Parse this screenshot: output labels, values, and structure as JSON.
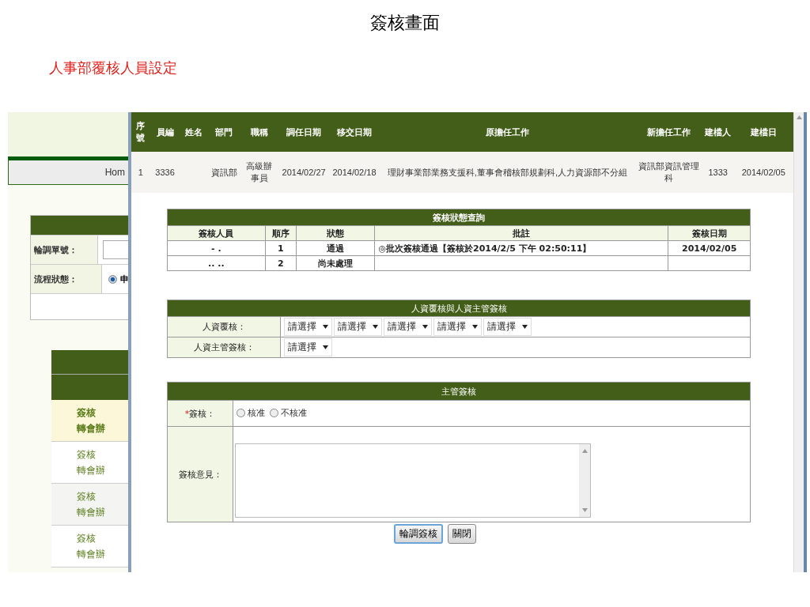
{
  "page_title": "簽核畫面",
  "subtitle": "人事部覆核人員設定",
  "background_page": {
    "nav_label": "Hom",
    "form": [
      {
        "label": "輪調單號：",
        "kind": "input"
      },
      {
        "label": "流程狀態：",
        "kind": "radio",
        "option": "申",
        "checked": true
      }
    ],
    "list_rows": [
      {
        "line_1": "簽核",
        "line_2": "轉會辦",
        "selected": true
      },
      {
        "line_1": "簽核",
        "line_2": "轉會辦",
        "selected": false
      },
      {
        "line_1": "簽核",
        "line_2": "轉會辦",
        "selected": false
      },
      {
        "line_1": "簽核",
        "line_2": "轉會辦",
        "selected": false
      }
    ]
  },
  "popup": {
    "table": {
      "columns": [
        "序號",
        "員編",
        "姓名",
        "部門",
        "職稱",
        "調任日期",
        "移交日期",
        "原擔任工作",
        "新擔任工作",
        "建檔人",
        "建檔日"
      ],
      "rows": [
        {
          "seq": "1",
          "emp_no": "3336",
          "dept": "資訊部",
          "title": "高級辦事員",
          "transfer_date": "2014/02/27",
          "handover_date": "2014/02/18",
          "original_job": "理財事業部業務支援科,董事會稽核部規劃科,人力資源部不分組",
          "new_job": "資訊部資訊管理科",
          "created_by": "1333",
          "created_date": "2014/02/05"
        }
      ]
    },
    "approval_status": {
      "title": "簽核狀態查詢",
      "columns": [
        "簽核人員",
        "順序",
        "狀態",
        "批註",
        "簽核日期"
      ],
      "rows": [
        [
          "-  .",
          "1",
          "通過",
          "◎批次簽核通過【簽核於2014/2/5 下午 02:50:11】",
          "2014/02/05"
        ],
        [
          ".. ..",
          "2",
          "尚未處理",
          "",
          ""
        ]
      ]
    },
    "hr_review": {
      "title": "人資覆核與人資主管簽核",
      "rows": [
        {
          "label": "人資覆核：",
          "selects": [
            "請選擇",
            "請選擇",
            "請選擇",
            "請選擇",
            "請選擇"
          ]
        },
        {
          "label": "人資主管簽核：",
          "selects": [
            "請選擇"
          ]
        }
      ]
    },
    "manager_review": {
      "title": "主管簽核",
      "required_mark": "*",
      "decision_label": "簽核：",
      "options": [
        {
          "label": "核准",
          "selected": false
        },
        {
          "label": "不核准",
          "selected": false
        }
      ],
      "comment_label": "簽核意見："
    },
    "buttons": [
      "輪調簽核",
      "關閉"
    ]
  }
}
